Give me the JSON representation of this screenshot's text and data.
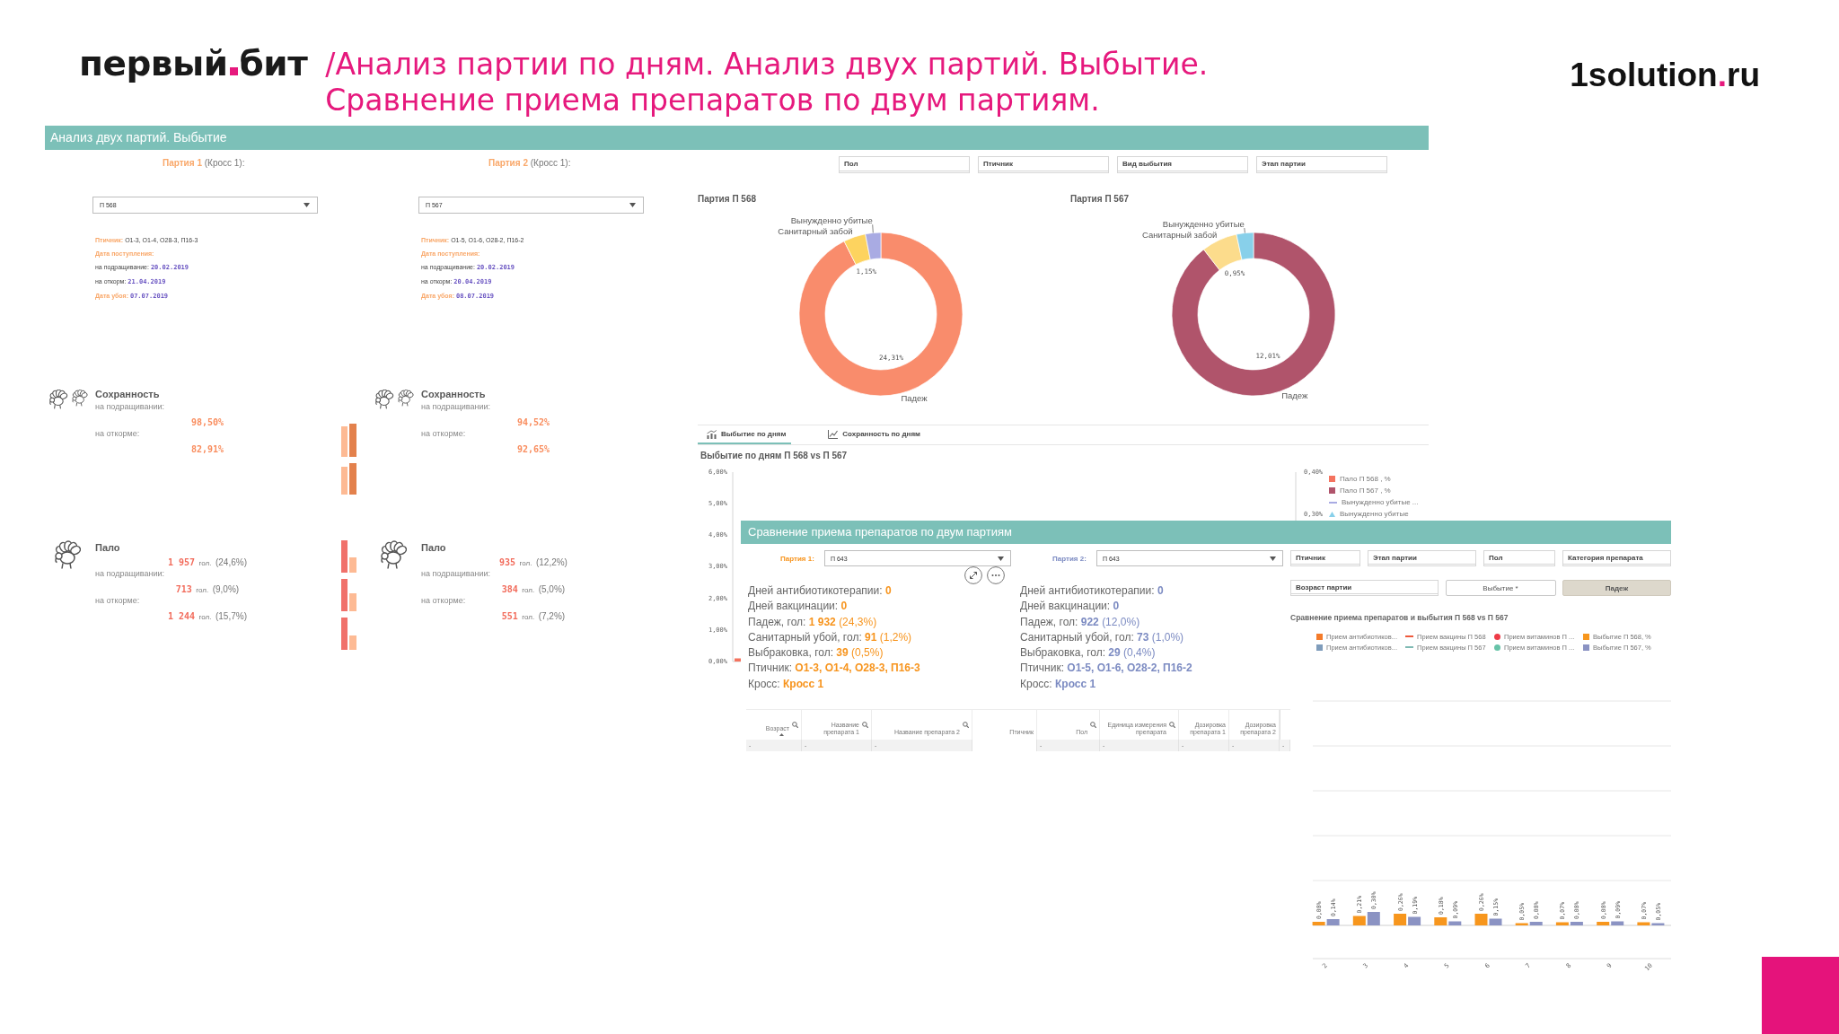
{
  "header": {
    "logo": {
      "word_1": "первый",
      "word_2": "бит"
    },
    "title_lines": [
      "/Анализ партии по дням. Анализ двух партий. Выбытие.",
      "Сравнение приема препаратов по двум партиям."
    ],
    "site": [
      {
        "text": "1solution",
        "accent": false
      },
      {
        "text": ".",
        "accent": true
      },
      {
        "text": "ru",
        "accent": false
      }
    ]
  },
  "dashboard": {
    "title": "Анализ двух партий. Выбытие",
    "parties": [
      {
        "label": "Партия 1",
        "cross": "(Кросс 1):",
        "selector": {
          "value": "П 568"
        },
        "info": [
          {
            "kind": "key",
            "label": "Птичник:",
            "value": "О1-3, О1-4, О28-3, П16-3"
          },
          {
            "kind": "heading",
            "label": "Дата поступления:"
          },
          {
            "kind": "date",
            "label": "на подращивание:",
            "value": "20.02.2019"
          },
          {
            "kind": "date",
            "label": "на откорм:",
            "value": "21.04.2019"
          },
          {
            "kind": "key_date",
            "label": "Дата убоя:",
            "value": "07.07.2019"
          }
        ],
        "survival": {
          "title": "Сохранность",
          "rows": [
            {
              "label": "на подращивании:",
              "value": "98,50%"
            },
            {
              "label": "на откорме:",
              "value": "82,91%"
            }
          ]
        },
        "mortality": {
          "title": "Пало",
          "total": {
            "count": "1 957",
            "unit": "гол.",
            "share": "(24,6%)"
          },
          "rows": [
            {
              "label": "на подращивании:",
              "count": "713",
              "unit": "гол.",
              "share": "(9,0%)"
            },
            {
              "label": "на откорме:",
              "count": "1 244",
              "unit": "гол.",
              "share": "(15,7%)"
            }
          ]
        }
      },
      {
        "label": "Партия 2",
        "cross": "(Кросс 1):",
        "selector": {
          "value": "П 567"
        },
        "info": [
          {
            "kind": "key",
            "label": "Птичник:",
            "value": "О1-5, О1-6, О28-2, П16-2"
          },
          {
            "kind": "heading",
            "label": "Дата поступления:"
          },
          {
            "kind": "date",
            "label": "на подращивание:",
            "value": "20.02.2019"
          },
          {
            "kind": "date",
            "label": "на откорм:",
            "value": "20.04.2019"
          },
          {
            "kind": "key_date",
            "label": "Дата убоя:",
            "value": "08.07.2019"
          }
        ],
        "survival": {
          "title": "Сохранность",
          "rows": [
            {
              "label": "на подращивании:",
              "value": "94,52%"
            },
            {
              "label": "на откорме:",
              "value": "92,65%"
            }
          ]
        },
        "mortality": {
          "title": "Пало",
          "total": {
            "count": "935",
            "unit": "гол.",
            "share": "(12,2%)"
          },
          "rows": [
            {
              "label": "на подращивании:",
              "count": "384",
              "unit": "гол.",
              "share": "(5,0%)"
            },
            {
              "label": "на откорме:",
              "count": "551",
              "unit": "гол.",
              "share": "(7,2%)"
            }
          ]
        }
      }
    ],
    "filters": [
      "Пол",
      "Птичник",
      "Вид выбытия",
      "Этап партии"
    ],
    "donuts": [
      {
        "chart_data": {
          "type": "donut",
          "title": "Партия П 568",
          "categories": [
            "Падеж",
            "Санитарный забой",
            "Вынужденно убитые"
          ],
          "values": [
            92.57,
            4.38,
            3.05
          ],
          "colors": [
            "#f98c6c",
            "#fdd35f",
            "#a9abe3"
          ],
          "annotations": [
            {
              "text": "24,31%"
            },
            {
              "text": "1,15%"
            }
          ]
        }
      },
      {
        "chart_data": {
          "type": "donut",
          "title": "Партия П 567",
          "categories": [
            "Падеж",
            "Санитарный забой",
            "Вынужденно убитые"
          ],
          "values": [
            89.56,
            7.08,
            3.36
          ],
          "colors": [
            "#b0546b",
            "#fcdc8c",
            "#88d0ea"
          ],
          "annotations": [
            {
              "text": "12,01%"
            },
            {
              "text": "0,95%"
            }
          ]
        }
      }
    ],
    "chart_tabs": [
      {
        "label": "Выбытие по дням",
        "kind": "bar",
        "selected": true
      },
      {
        "label": "Сохранность по дням",
        "kind": "line",
        "selected": false
      }
    ],
    "daily_chart": {
      "chart_data": {
        "type": "bar",
        "title": "Выбытие по дням П 568 vs П 567",
        "legend": "right",
        "ylim": [
          0,
          6
        ],
        "yticks": [
          {
            "value": 6,
            "label": "6,00%"
          },
          {
            "value": 5,
            "label": "5,00%"
          },
          {
            "value": 4,
            "label": "4,00%"
          },
          {
            "value": 3,
            "label": "3,00%"
          },
          {
            "value": 2,
            "label": "2,00%"
          },
          {
            "value": 1,
            "label": "1,00%"
          },
          {
            "value": 0,
            "label": "0,00%"
          }
        ],
        "y2lim": [
          -0.05,
          0.4
        ],
        "y2ticks": [
          {
            "value": 0.4,
            "label": "0,40%"
          },
          {
            "value": 0.3,
            "label": "0,30%"
          }
        ],
        "series": [
          {
            "name": "Пало П 568 , %",
            "color": "#f4735f",
            "values": [
              0.1
            ]
          },
          {
            "name": "Пало П 567 , %",
            "color": "#b0546b",
            "values": [
              0
            ]
          }
        ]
      },
      "legend_items": [
        {
          "name": "Вынужденно убитые ...",
          "color": "#a9abe3",
          "kind": "line"
        },
        {
          "name": "Вынужденно убитые",
          "color": "#88d0ea",
          "kind": "triangle"
        }
      ]
    }
  },
  "overlay": {
    "title": "Сравнение приема препаратов по двум партиям",
    "parties": [
      {
        "label": "Партия 1:",
        "color": "#f7941d",
        "selector": {
          "value": "П 643"
        },
        "hover_tools": [
          {
            "kind": "expand"
          },
          {
            "kind": "more"
          }
        ],
        "stats": [
          {
            "label": "Дней антибиотикотерапии:",
            "value": "0"
          },
          {
            "label": "Дней вакцинации:",
            "value": "0"
          },
          {
            "label": "Падеж, гол:",
            "value": "1 932",
            "share": "(24,3%)"
          },
          {
            "label": "Санитарный убой, гол:",
            "value": "91",
            "share": "(1,2%)"
          },
          {
            "label": "Выбраковка, гол:",
            "value": "39",
            "share": "(0,5%)"
          },
          {
            "label": "Птичник:",
            "value": "О1-3, О1-4, О28-3, П16-3"
          },
          {
            "label": "Кросс:",
            "value": "Кросс 1"
          }
        ]
      },
      {
        "label": "Партия 2:",
        "color": "#7c8bc2",
        "selector": {
          "value": "П 643"
        },
        "stats": [
          {
            "label": "Дней антибиотикотерапии:",
            "value": "0"
          },
          {
            "label": "Дней вакцинации:",
            "value": "0"
          },
          {
            "label": "Падеж, гол:",
            "value": "922",
            "share": "(12,0%)"
          },
          {
            "label": "Санитарный убой, гол:",
            "value": "73",
            "share": "(1,0%)"
          },
          {
            "label": "Выбраковка, гол:",
            "value": "29",
            "share": "(0,4%)"
          },
          {
            "label": "Птичник:",
            "value": "О1-5, О1-6, О28-2, П16-2"
          },
          {
            "label": "Кросс:",
            "value": "Кросс 1"
          }
        ]
      }
    ],
    "filters": [
      "Птичник",
      "Этап партии",
      "Пол",
      "Категория препарата"
    ],
    "filters_2": [
      "Возраст партии"
    ],
    "measure_buttons": [
      {
        "label": "Выбытие *",
        "selected": false
      },
      {
        "label": "Падеж",
        "selected": true
      }
    ],
    "chart": {
      "chart_data": {
        "type": "bar",
        "title": "Сравнение приема препаратов и выбытия П 568 vs П 567",
        "legend": "top",
        "categories": [
          "2",
          "3",
          "4",
          "5",
          "6",
          "7",
          "8",
          "9",
          "10"
        ],
        "ylim": [
          -0.74,
          5
        ],
        "series": [
          {
            "name": "Выбытие П 568, %",
            "color": "#f7961d",
            "values": [
              0.08,
              0.21,
              0.26,
              0.18,
              0.26,
              0.05,
              0.07,
              0.08,
              0.07
            ],
            "value_labels": [
              "0,08%",
              "0,21%",
              "0,26%",
              "0,18%",
              "0,26%",
              "0,05%",
              "0,07%",
              "0,08%",
              "0,07%"
            ]
          },
          {
            "name": "Выбытие П 567, %",
            "color": "#8b93c3",
            "values": [
              0.14,
              0.3,
              0.19,
              0.09,
              0.15,
              0.08,
              0.08,
              0.09,
              0.05
            ],
            "value_labels": [
              "0,14%",
              "0,30%",
              "0,19%",
              "0,09%",
              "0,15%",
              "0,08%",
              "0,08%",
              "0,09%",
              "0,05%"
            ]
          }
        ]
      },
      "legend_items": [
        {
          "name": "Прием антибиотиков...",
          "color": "#f47b2a",
          "kind": "square"
        },
        {
          "name": "Прием антибиотиков...",
          "color": "#7f9cbb",
          "kind": "square"
        },
        {
          "name": "Прием вакцины П 568",
          "color": "#ee5a3c",
          "kind": "line"
        },
        {
          "name": "Прием вакцины П 567",
          "color": "#7fbab3",
          "kind": "line"
        },
        {
          "name": "Прием витаминов П ...",
          "color": "#ee3b47",
          "kind": "dot"
        },
        {
          "name": "Прием витаминов П ...",
          "color": "#67c3a8",
          "kind": "dot"
        }
      ]
    },
    "table": {
      "columns": [
        {
          "label": "Возраст",
          "searchable": true,
          "sorted": true,
          "cells": [
            "-"
          ]
        },
        {
          "label": "Название препарата 1",
          "searchable": true,
          "sorted": false,
          "cells": [
            "-"
          ]
        },
        {
          "label": "Название препарата 2",
          "searchable": true,
          "sorted": false,
          "cells": [
            "-"
          ]
        },
        {
          "label": "Птичник",
          "searchable": false,
          "sorted": false
        },
        {
          "label": "Пол",
          "searchable": true,
          "sorted": false,
          "cells": [
            "-"
          ]
        },
        {
          "label": "Единица измерения препарата",
          "searchable": true,
          "sorted": false,
          "cells": [
            "-"
          ]
        },
        {
          "label": "Дозировка препарата 1",
          "searchable": false,
          "sorted": false,
          "cells": [
            "-"
          ]
        },
        {
          "label": "Дозировка препарата 2",
          "searchable": false,
          "sorted": false,
          "cells": [
            "-"
          ]
        },
        {
          "searchable": false,
          "sorted": false,
          "cells": [
            "-"
          ]
        }
      ]
    }
  }
}
